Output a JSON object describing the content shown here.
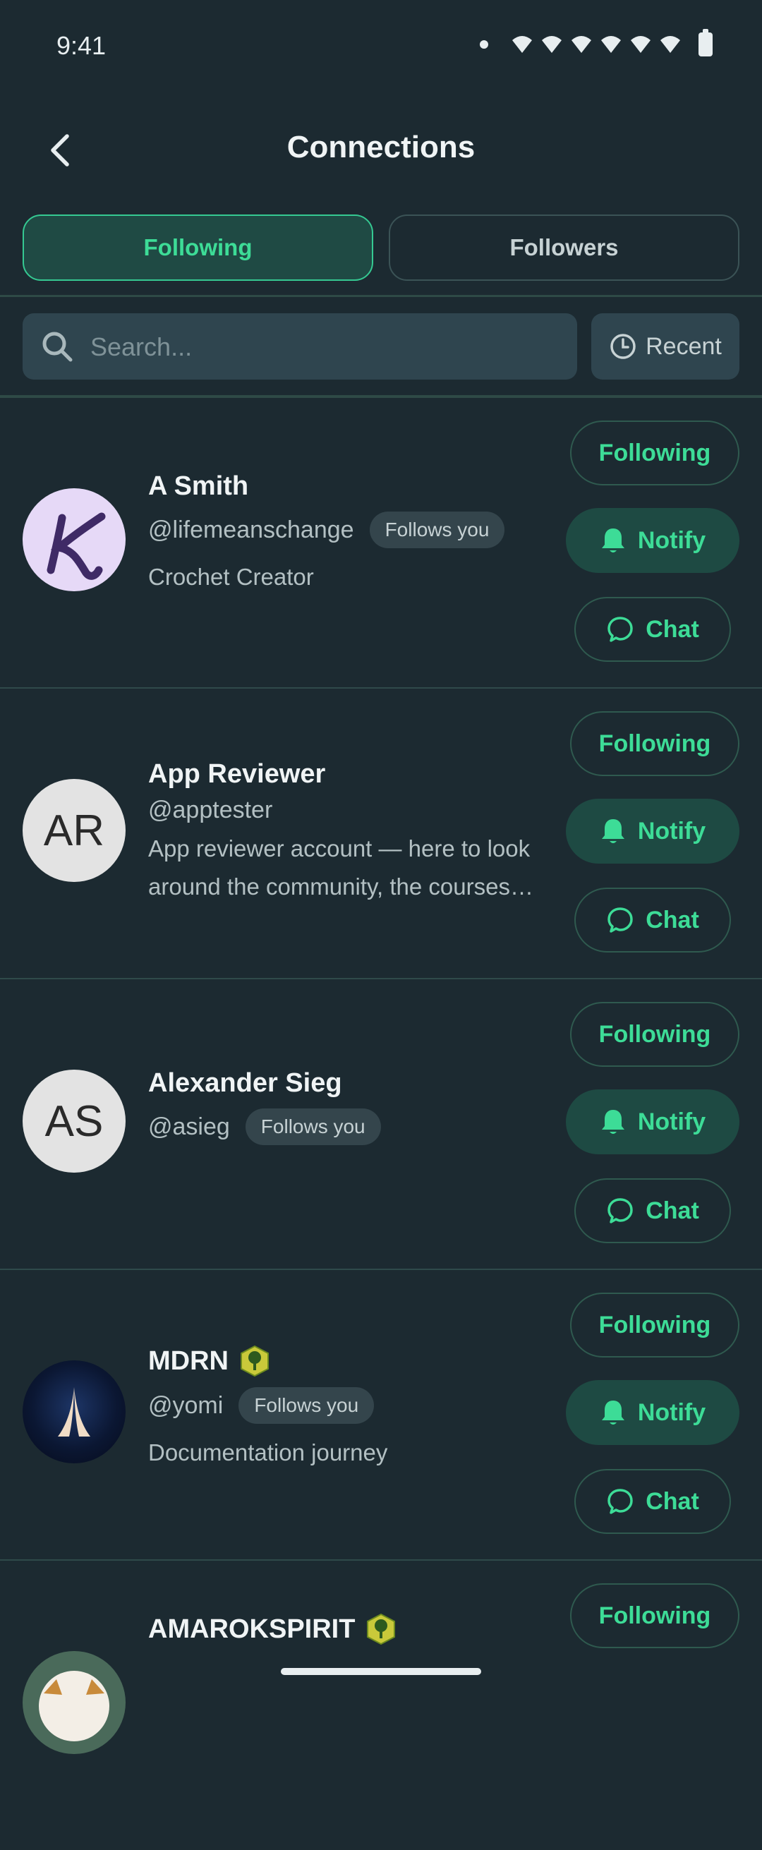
{
  "status_bar": {
    "time": "9:41"
  },
  "header": {
    "title": "Connections"
  },
  "tabs": [
    {
      "label": "Following",
      "active": true
    },
    {
      "label": "Followers",
      "active": false
    }
  ],
  "search": {
    "placeholder": "Search...",
    "value": ""
  },
  "sort": {
    "label": "Recent"
  },
  "actions": {
    "following_label": "Following",
    "notify_label": "Notify",
    "chat_label": "Chat"
  },
  "users": [
    {
      "name": "A Smith",
      "handle": "@lifemeanschange",
      "follows_you": "Follows you",
      "bio": "Crochet Creator",
      "avatar": "k-letter"
    },
    {
      "name": "App Reviewer",
      "handle": "@apptester",
      "follows_you": "",
      "bio": "App reviewer account — here to look around the community, the courses…",
      "avatar_initials": "AR"
    },
    {
      "name": "Alexander Sieg",
      "handle": "@asieg",
      "follows_you": "Follows you",
      "bio": "",
      "avatar_initials": "AS"
    },
    {
      "name": "MDRN",
      "handle": "@yomi",
      "follows_you": "Follows you",
      "bio": "Documentation journey",
      "avatar": "mdrn-logo",
      "badge": "tree-badge-icon"
    },
    {
      "name": "AMAROKSPIRIT",
      "handle": "",
      "follows_you": "",
      "bio": "",
      "avatar": "amarok",
      "badge": "tree-badge-icon"
    }
  ],
  "colors": {
    "background": "#1c2a31",
    "accent": "#3ddc97",
    "notify_bg": "#1e4a43"
  }
}
